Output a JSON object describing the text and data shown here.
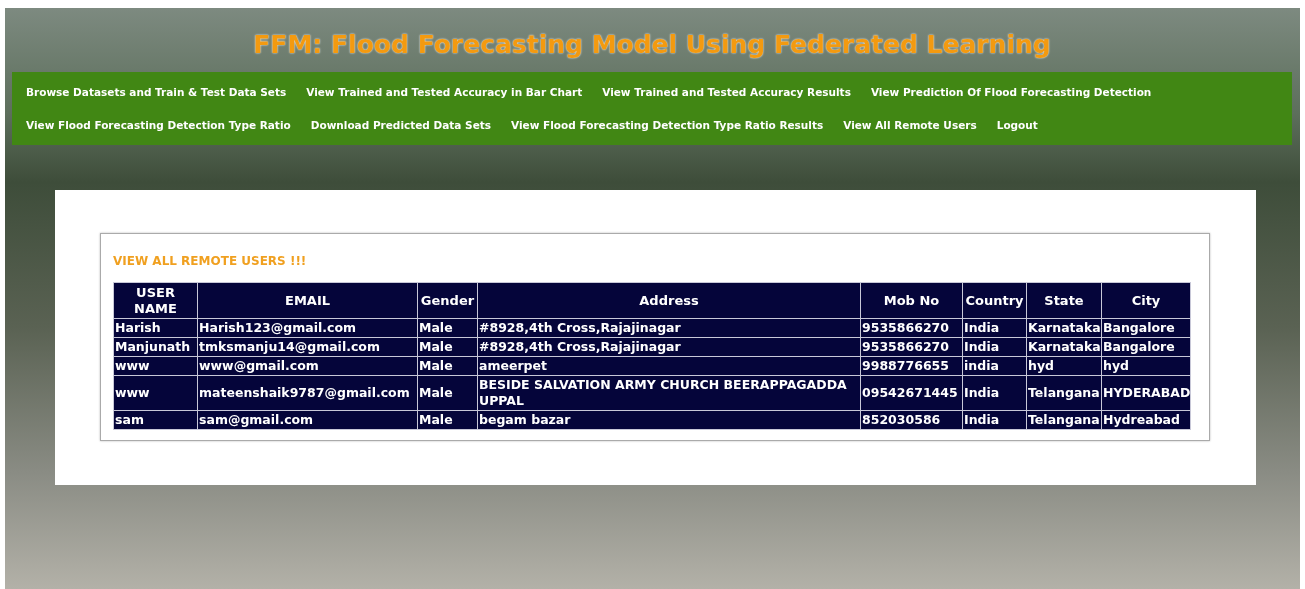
{
  "header": {
    "title": "FFM: Flood Forecasting Model Using Federated Learning"
  },
  "nav": [
    {
      "label": "Browse Datasets and Train & Test Data Sets"
    },
    {
      "label": "View Trained and Tested Accuracy in Bar Chart"
    },
    {
      "label": "View Trained and Tested Accuracy Results"
    },
    {
      "label": "View Prediction Of Flood Forecasting Detection"
    },
    {
      "label": "View Flood Forecasting Detection Type Ratio"
    },
    {
      "label": "Download Predicted Data Sets"
    },
    {
      "label": "View Flood Forecasting Detection Type Ratio Results"
    },
    {
      "label": "View All Remote Users"
    },
    {
      "label": "Logout"
    }
  ],
  "section_title": "VIEW ALL REMOTE USERS !!!",
  "table": {
    "columns": [
      "USER NAME",
      "EMAIL",
      "Gender",
      "Address",
      "Mob No",
      "Country",
      "State",
      "City"
    ],
    "rows": [
      [
        "Harish",
        "Harish123@gmail.com",
        "Male",
        "#8928,4th Cross,Rajajinagar",
        "9535866270",
        "India",
        "Karnataka",
        "Bangalore"
      ],
      [
        "Manjunath",
        "tmksmanju14@gmail.com",
        "Male",
        "#8928,4th Cross,Rajajinagar",
        "9535866270",
        "India",
        "Karnataka",
        "Bangalore"
      ],
      [
        "www",
        "www@gmail.com",
        "Male",
        "ameerpet",
        "9988776655",
        "india",
        "hyd",
        "hyd"
      ],
      [
        "www",
        "mateenshaik9787@gmail.com",
        "Male",
        "BESIDE SALVATION ARMY CHURCH BEERAPPAGADDA UPPAL",
        "09542671445",
        "India",
        "Telangana",
        "HYDERABAD"
      ],
      [
        "sam",
        "sam@gmail.com",
        "Male",
        "begam bazar",
        "852030586",
        "India",
        "Telangana",
        "Hydreabad"
      ]
    ]
  }
}
